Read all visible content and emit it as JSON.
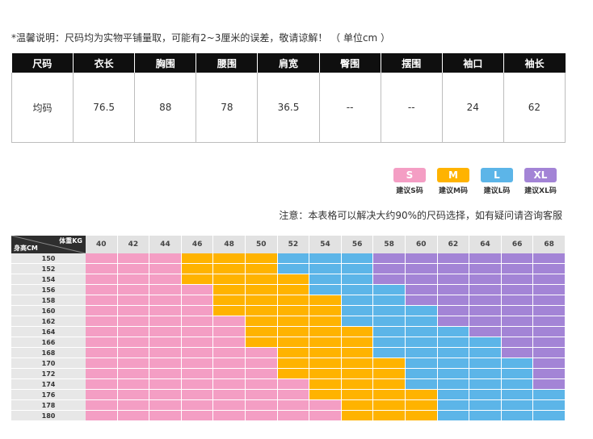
{
  "notice_top": "*温馨说明：尺码均为实物平铺量取，可能有2~3厘米的误差，敬请谅解！  （ 单位cm ）",
  "size_table": {
    "headers": [
      "尺码",
      "衣长",
      "胸围",
      "腰围",
      "肩宽",
      "臀围",
      "摆围",
      "袖口",
      "袖长"
    ],
    "rows": [
      [
        "均码",
        "76.5",
        "88",
        "78",
        "36.5",
        "--",
        "--",
        "24",
        "62"
      ]
    ]
  },
  "legend": [
    {
      "code": "S",
      "label": "建议S码",
      "color": "#f49ec4"
    },
    {
      "code": "M",
      "label": "建议M码",
      "color": "#ffb300"
    },
    {
      "code": "L",
      "label": "建议L码",
      "color": "#5cb5e8"
    },
    {
      "code": "XL",
      "label": "建议XL码",
      "color": "#a384d6"
    }
  ],
  "notice_mid": "注意：本表格可以解决大约90%的尺码选择，如有疑问请咨询客服",
  "chart": {
    "weight_label": "体重KG",
    "height_label": "身高CM",
    "weights": [
      "40",
      "42",
      "44",
      "46",
      "48",
      "50",
      "52",
      "54",
      "56",
      "58",
      "60",
      "62",
      "64",
      "66",
      "68"
    ],
    "heights": [
      "150",
      "152",
      "154",
      "156",
      "158",
      "160",
      "162",
      "164",
      "166",
      "168",
      "170",
      "172",
      "174",
      "176",
      "178",
      "180"
    ],
    "size_codes": [
      "S",
      "M",
      "L",
      "XL"
    ],
    "grid": [
      [
        0,
        0,
        0,
        1,
        1,
        1,
        2,
        2,
        2,
        3,
        3,
        3,
        3,
        3,
        3
      ],
      [
        0,
        0,
        0,
        1,
        1,
        1,
        2,
        2,
        2,
        3,
        3,
        3,
        3,
        3,
        3
      ],
      [
        0,
        0,
        0,
        1,
        1,
        1,
        1,
        2,
        2,
        3,
        3,
        3,
        3,
        3,
        3
      ],
      [
        0,
        0,
        0,
        0,
        1,
        1,
        1,
        2,
        2,
        2,
        3,
        3,
        3,
        3,
        3
      ],
      [
        0,
        0,
        0,
        0,
        1,
        1,
        1,
        1,
        2,
        2,
        3,
        3,
        3,
        3,
        3
      ],
      [
        0,
        0,
        0,
        0,
        1,
        1,
        1,
        1,
        2,
        2,
        2,
        3,
        3,
        3,
        3
      ],
      [
        0,
        0,
        0,
        0,
        0,
        1,
        1,
        1,
        2,
        2,
        2,
        3,
        3,
        3,
        3
      ],
      [
        0,
        0,
        0,
        0,
        0,
        1,
        1,
        1,
        1,
        2,
        2,
        2,
        3,
        3,
        3
      ],
      [
        0,
        0,
        0,
        0,
        0,
        1,
        1,
        1,
        1,
        2,
        2,
        2,
        2,
        3,
        3
      ],
      [
        0,
        0,
        0,
        0,
        0,
        0,
        1,
        1,
        1,
        2,
        2,
        2,
        2,
        3,
        3
      ],
      [
        0,
        0,
        0,
        0,
        0,
        0,
        1,
        1,
        1,
        1,
        2,
        2,
        2,
        2,
        3
      ],
      [
        0,
        0,
        0,
        0,
        0,
        0,
        1,
        1,
        1,
        1,
        2,
        2,
        2,
        2,
        3
      ],
      [
        0,
        0,
        0,
        0,
        0,
        0,
        0,
        1,
        1,
        1,
        2,
        2,
        2,
        2,
        3
      ],
      [
        0,
        0,
        0,
        0,
        0,
        0,
        0,
        1,
        1,
        1,
        1,
        2,
        2,
        2,
        2
      ],
      [
        0,
        0,
        0,
        0,
        0,
        0,
        0,
        0,
        1,
        1,
        1,
        2,
        2,
        2,
        2
      ],
      [
        0,
        0,
        0,
        0,
        0,
        0,
        0,
        0,
        1,
        1,
        1,
        2,
        2,
        2,
        2
      ]
    ]
  }
}
